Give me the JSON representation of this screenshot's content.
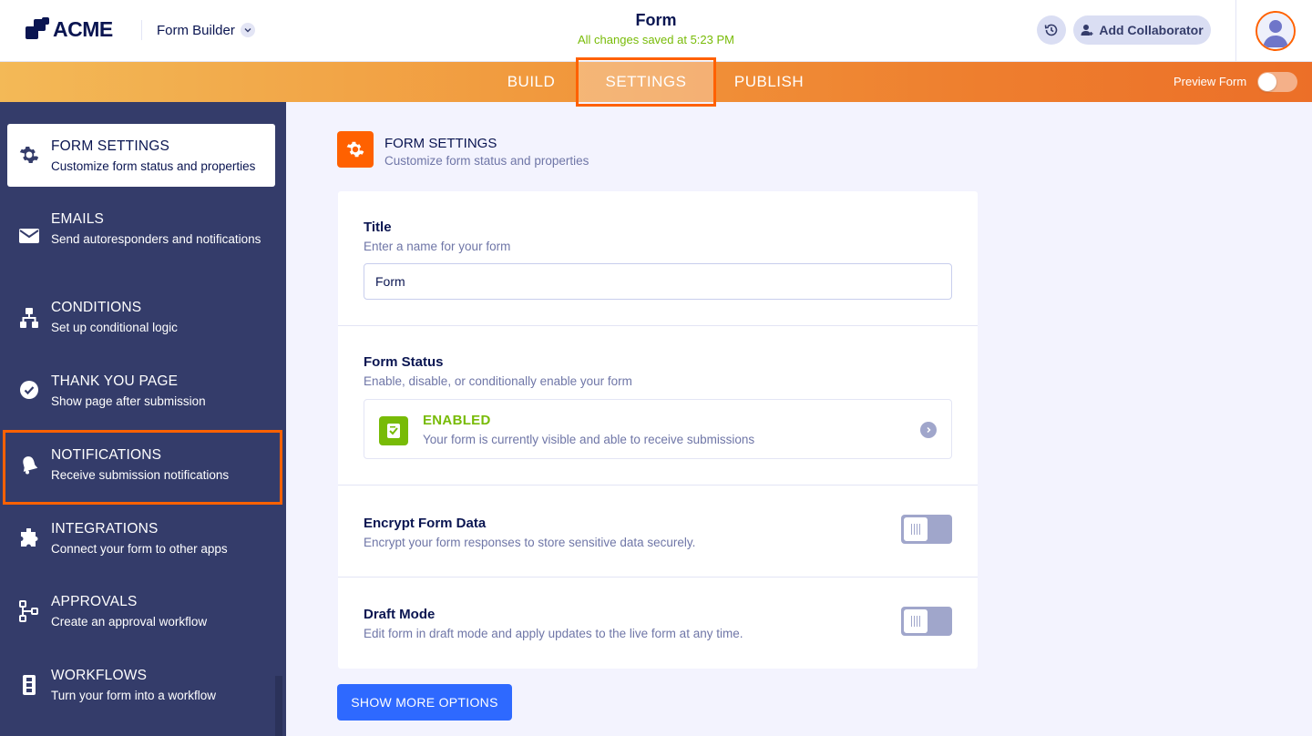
{
  "header": {
    "brand": "ACME",
    "app_switcher": "Form Builder",
    "form_title": "Form",
    "save_status": "All changes saved at 5:23 PM",
    "add_collaborator": "Add Collaborator"
  },
  "nav": {
    "tabs": [
      {
        "label": "BUILD",
        "active": false
      },
      {
        "label": "SETTINGS",
        "active": true
      },
      {
        "label": "PUBLISH",
        "active": false
      }
    ],
    "preview_label": "Preview Form",
    "preview_on": false
  },
  "sidebar": {
    "items": [
      {
        "title": "FORM SETTINGS",
        "desc": "Customize form status and properties",
        "icon": "gear-icon",
        "active": true
      },
      {
        "title": "EMAILS",
        "desc": "Send autoresponders and notifications",
        "icon": "envelope-icon",
        "active": false
      },
      {
        "title": "CONDITIONS",
        "desc": "Set up conditional logic",
        "icon": "hierarchy-icon",
        "active": false
      },
      {
        "title": "THANK YOU PAGE",
        "desc": "Show page after submission",
        "icon": "check-circle-icon",
        "active": false
      },
      {
        "title": "NOTIFICATIONS",
        "desc": "Receive submission notifications",
        "icon": "bell-icon",
        "active": false
      },
      {
        "title": "INTEGRATIONS",
        "desc": "Connect your form to other apps",
        "icon": "puzzle-icon",
        "active": false
      },
      {
        "title": "APPROVALS",
        "desc": "Create an approval workflow",
        "icon": "flow-icon",
        "active": false
      },
      {
        "title": "WORKFLOWS",
        "desc": "Turn your form into a workflow",
        "icon": "workflow-icon",
        "active": false
      }
    ]
  },
  "main": {
    "heading": "FORM SETTINGS",
    "subheading": "Customize form status and properties",
    "title_section": {
      "label": "Title",
      "desc": "Enter a name for your form",
      "value": "Form"
    },
    "status_section": {
      "label": "Form Status",
      "desc": "Enable, disable, or conditionally enable your form",
      "status": "ENABLED",
      "status_desc": "Your form is currently visible and able to receive submissions"
    },
    "encrypt_section": {
      "label": "Encrypt Form Data",
      "desc": "Encrypt your form responses to store sensitive data securely.",
      "enabled": false
    },
    "draft_section": {
      "label": "Draft Mode",
      "desc": "Edit form in draft mode and apply updates to the live form at any time.",
      "enabled": false
    },
    "show_more": "SHOW MORE OPTIONS"
  },
  "colors": {
    "accent": "#ff6100",
    "enabled_green": "#78bb07",
    "primary_blue": "#2e69ff",
    "sidebar_bg": "#343c6a"
  }
}
